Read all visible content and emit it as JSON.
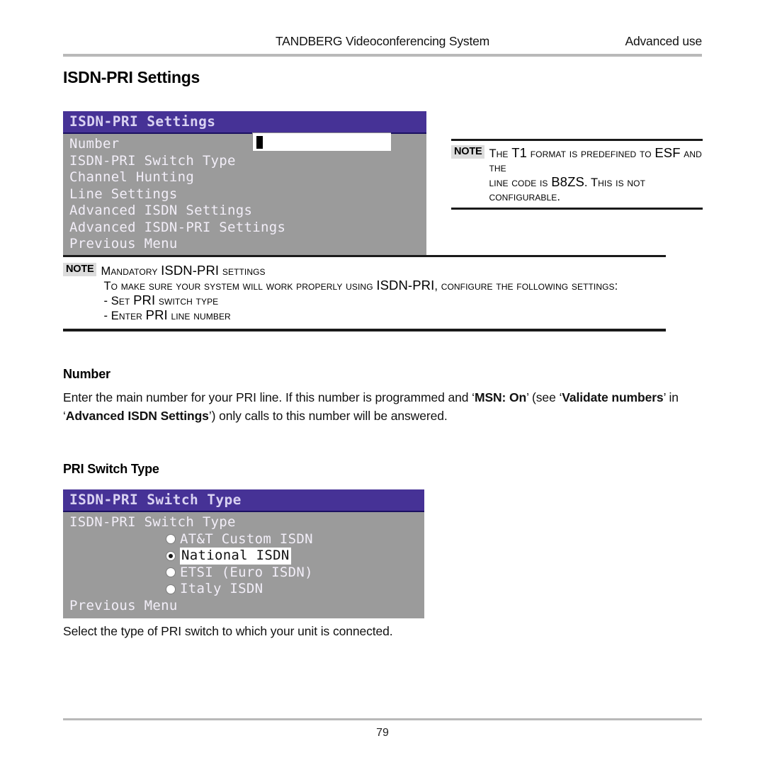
{
  "header": {
    "center_title": "TANDBERG Videoconferencing System",
    "right_title": "Advanced use"
  },
  "page_title": "ISDN-PRI Settings",
  "menus": [
    {
      "id": "isdn-pri-settings",
      "titlebar": "ISDN-PRI Settings",
      "items": [
        "Number",
        "ISDN-PRI Switch Type",
        "Channel Hunting",
        "Line Settings",
        "Advanced ISDN Settings",
        "Advanced ISDN-PRI Settings",
        "Previous Menu"
      ],
      "number_field": {
        "value": "",
        "caret": "block-cursor"
      }
    },
    {
      "id": "isdn-pri-switch-type",
      "titlebar": "ISDN-PRI Switch Type",
      "group_label": "ISDN-PRI Switch Type",
      "options": [
        {
          "label": "AT&T Custom ISDN",
          "selected": false
        },
        {
          "label": "National ISDN",
          "selected": true
        },
        {
          "label": "ETSI (Euro ISDN)",
          "selected": false
        },
        {
          "label": "Italy ISDN",
          "selected": false
        }
      ],
      "footer_item": "Previous Menu"
    }
  ],
  "notes": {
    "t1_format": {
      "tag": "NOTE",
      "line1_a": "The ",
      "line1_b": "T1",
      "line1_c": " format is predefined to ",
      "line1_d": "ESF",
      "line1_e": " and the",
      "line2_a": "line code is ",
      "line2_b": "B8ZS",
      "line2_c": ". This is not configurable."
    },
    "mandatory": {
      "tag": "NOTE",
      "title_a": "Mandatory ",
      "title_b": "ISDN-PRI",
      "title_c": " settings",
      "line1_a": "To make sure your system will work properly using ",
      "line1_b": "ISDN-PRI",
      "line1_c": ", configure the following settings:",
      "line2_a": "- Set ",
      "line2_b": "PRI",
      "line2_c": " switch type",
      "line3_a": "- Enter ",
      "line3_b": "PRI",
      "line3_c": " line number"
    }
  },
  "sections": [
    {
      "heading": "Number",
      "paragraph": {
        "t1": "Enter the main number for your PRI line. If this number is programmed and ‘",
        "b1": "MSN: On",
        "t2": "’ (see ‘",
        "b2": "Validate numbers",
        "t3": "’ in ‘",
        "b3": "Advanced ISDN Settings",
        "t4": "’) only calls to this number will be answered."
      }
    },
    {
      "heading": "PRI Switch Type",
      "paragraph_text": "Select the type of PRI switch to which your unit is connected."
    }
  ],
  "footer": {
    "page_number": "79"
  }
}
